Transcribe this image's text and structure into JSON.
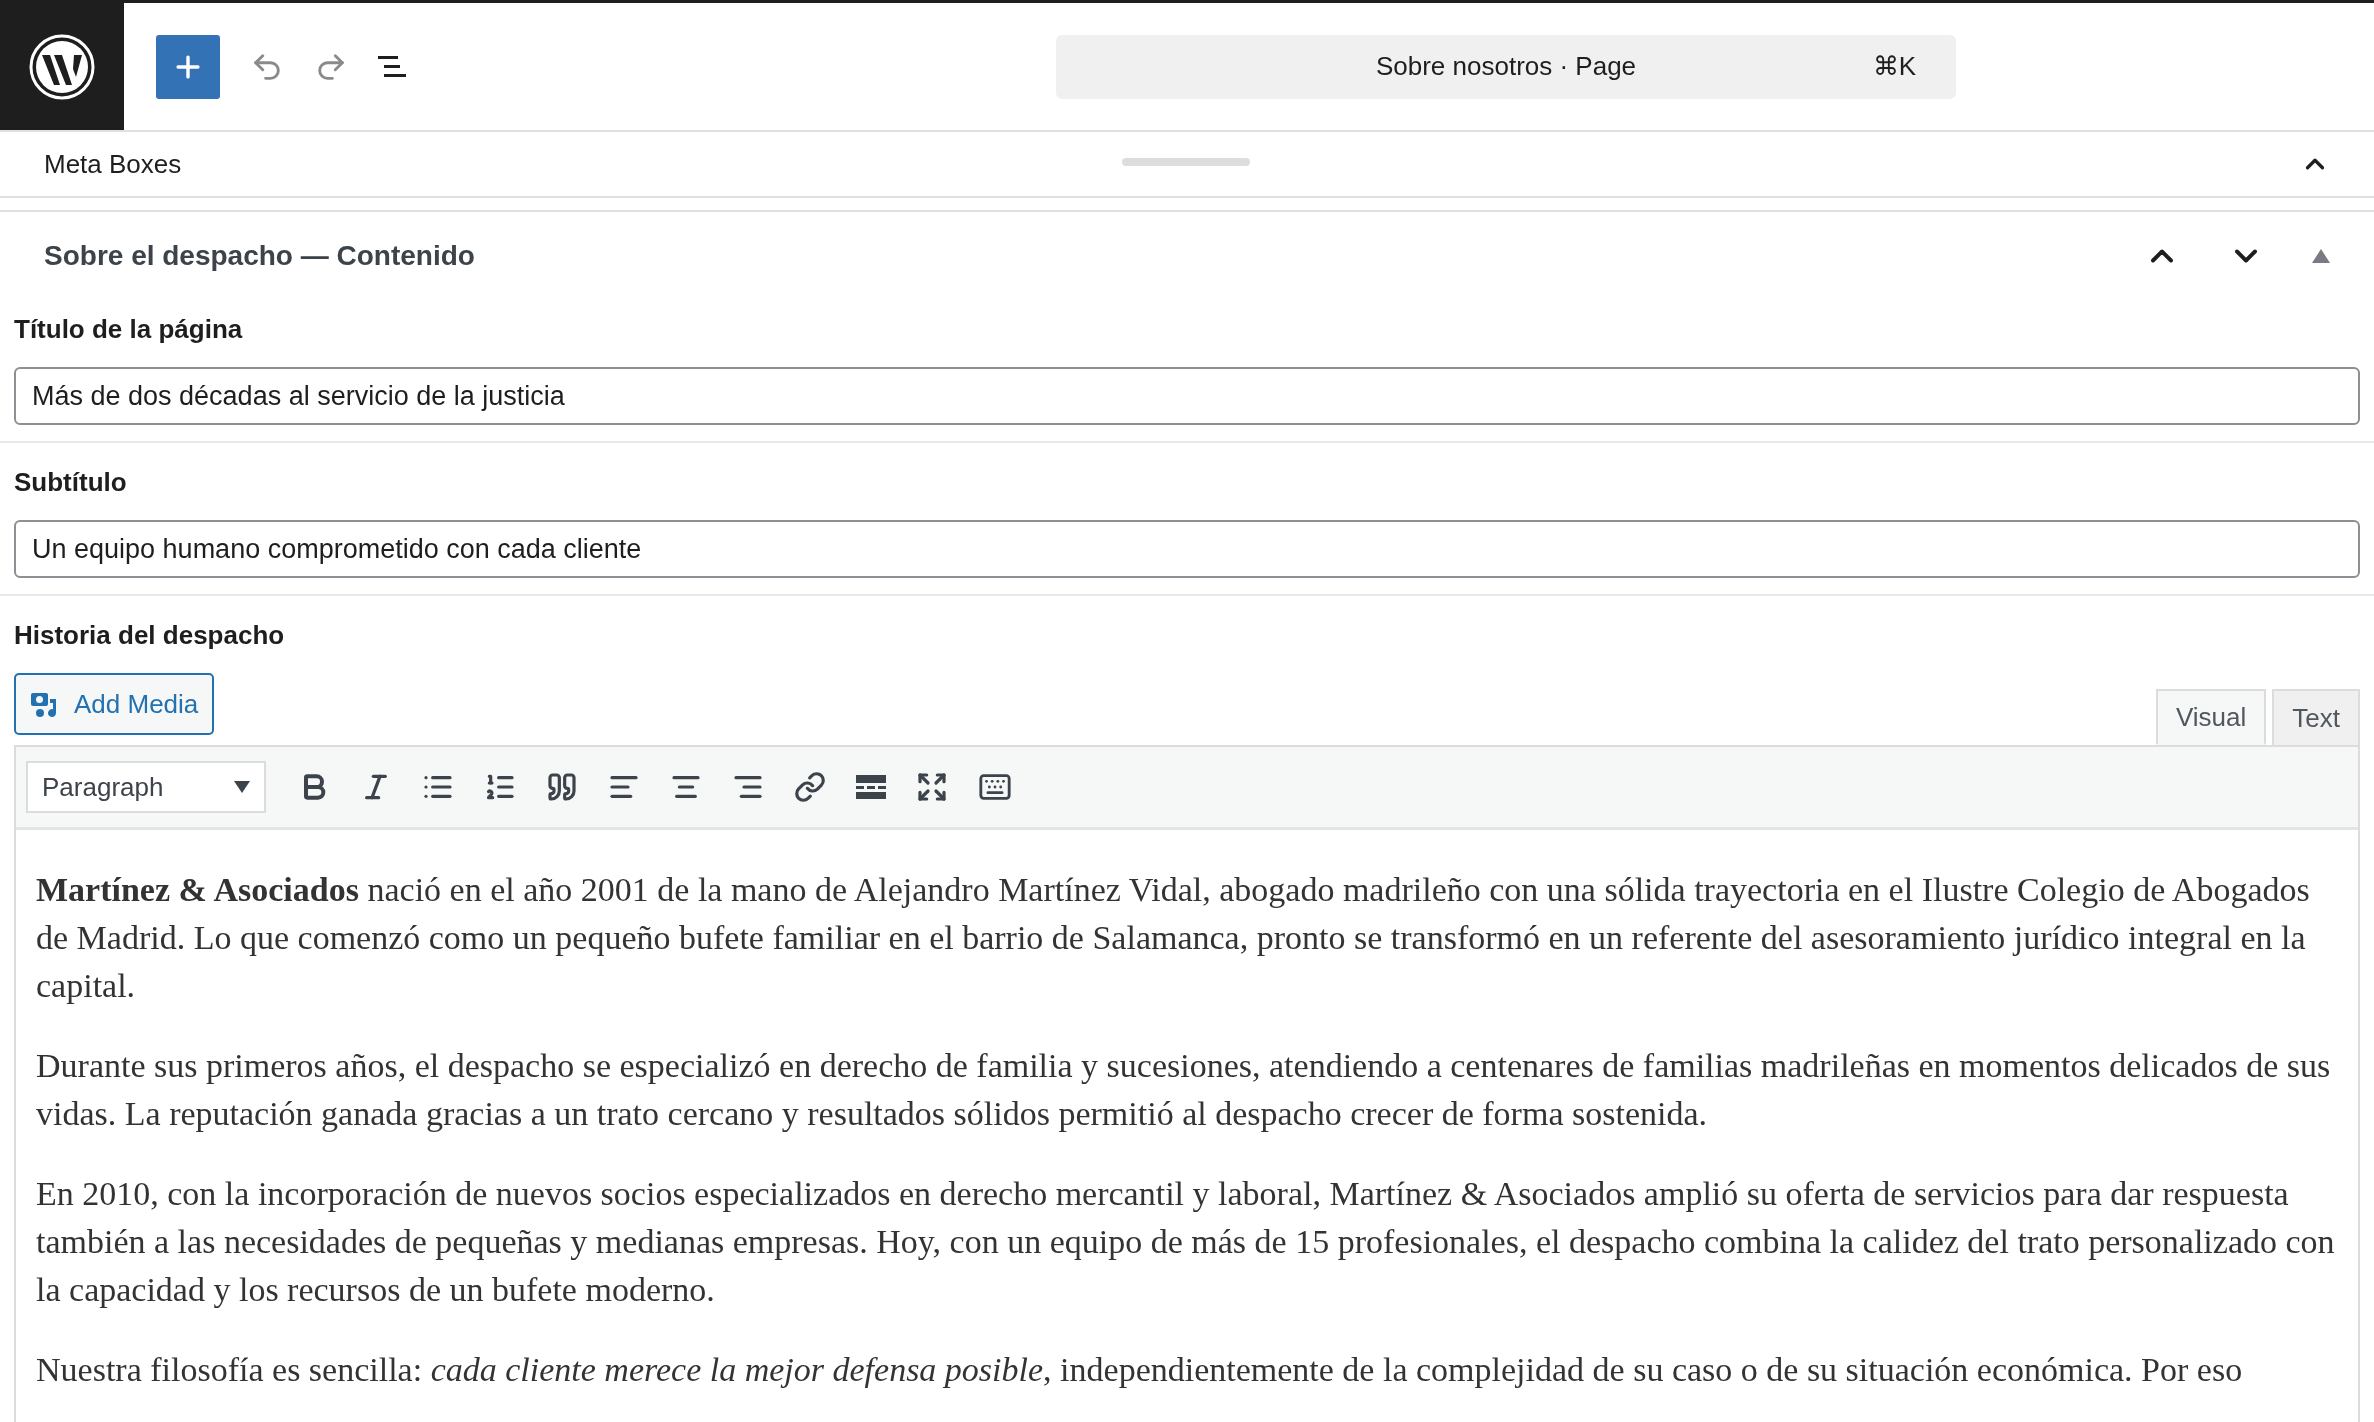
{
  "top_bar": {
    "command_center": {
      "title": "Sobre nosotros · Page",
      "shortcut": "⌘K"
    }
  },
  "meta_boxes": {
    "label": "Meta Boxes",
    "expanded": true
  },
  "panel": {
    "title": "Sobre el despacho — Contenido",
    "expanded": true,
    "fields": [
      {
        "kind": "text",
        "label": "Título de la página",
        "value": "Más de dos décadas al servicio de la justicia"
      },
      {
        "kind": "text",
        "label": "Subtítulo",
        "value": "Un equipo humano comprometido con cada cliente"
      },
      {
        "kind": "editor",
        "label": "Historia del despacho",
        "add_media": "Add Media",
        "tabs": [
          {
            "label": "Visual",
            "selected": true
          },
          {
            "label": "Text",
            "selected": false
          }
        ],
        "format": "Paragraph",
        "paragraphs": [
          "**Martínez & Asociados** nació en el año 2001 de la mano de Alejandro Martínez Vidal, abogado madrileño con una sólida trayectoria en el Ilustre Colegio de Abogados de Madrid. Lo que comenzó como un pequeño bufete familiar en el barrio de Salamanca, pronto se transformó en un referente del asesoramiento jurídico integral en la capital.",
          "Durante sus primeros años, el despacho se especializó en derecho de familia y sucesiones, atendiendo a centenares de familias madrileñas en momentos delicados de sus vidas. La reputación ganada gracias a un trato cercano y resultados sólidos permitió al despacho crecer de forma sostenida.",
          "En 2010, con la incorporación de nuevos socios especializados en derecho mercantil y laboral, Martínez & Asociados amplió su oferta de servicios para dar respuesta también a las necesidades de pequeñas y medianas empresas. Hoy, con un equipo de más de 15 profesionales, el despacho combina la calidez del trato personalizado con la capacidad y los recursos de un bufete moderno.",
          "Nuestra filosofía es sencilla: *cada cliente merece la mejor defensa posible*, independientemente de la complejidad de su caso o de su situación económica. Por eso"
        ]
      }
    ]
  }
}
